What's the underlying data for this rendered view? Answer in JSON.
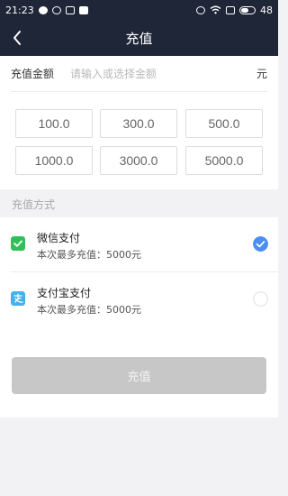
{
  "status_bar": {
    "time": "21:23",
    "battery_level": "48"
  },
  "header": {
    "title": "充值"
  },
  "amount": {
    "label": "充值金额",
    "placeholder": "请输入或选择金额",
    "unit": "元"
  },
  "preset_amounts": [
    "100.0",
    "300.0",
    "500.0",
    "1000.0",
    "3000.0",
    "5000.0"
  ],
  "payment": {
    "section_title": "充值方式",
    "methods": [
      {
        "name": "微信支付",
        "limit": "本次最多充值：5000元",
        "selected": true,
        "icon": "wechat-pay-icon",
        "color": "#2ec15a"
      },
      {
        "name": "支付宝支付",
        "limit": "本次最多充值：5000元",
        "selected": false,
        "icon": "alipay-icon",
        "color": "#41b3e8"
      }
    ]
  },
  "submit": {
    "label": "充值"
  },
  "colors": {
    "header_bg": "#1e2638",
    "selected": "#4a8ef2",
    "button_disabled": "#c7c7c7"
  }
}
